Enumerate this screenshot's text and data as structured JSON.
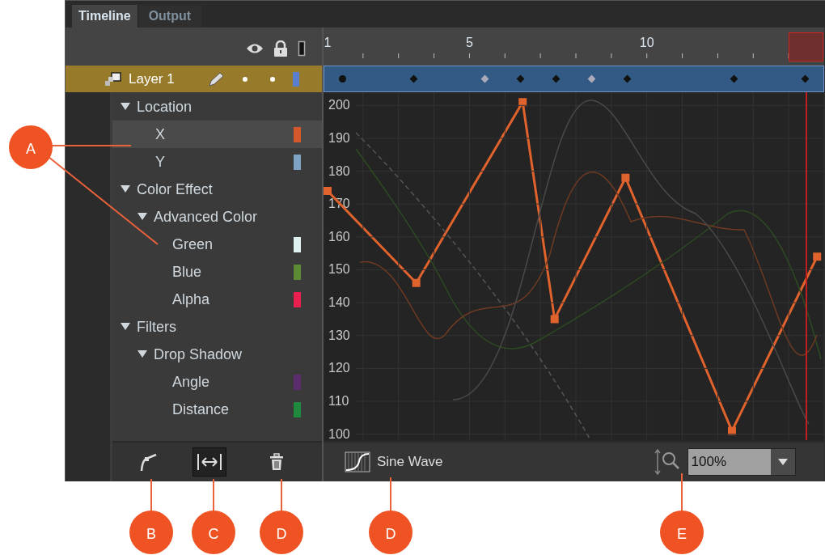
{
  "tabs": [
    {
      "label": "Timeline",
      "selected": true
    },
    {
      "label": "Output",
      "selected": false
    }
  ],
  "layer": {
    "name": "Layer 1"
  },
  "keyframes": [
    {
      "kind": "circle"
    },
    {
      "kind": "empty"
    },
    {
      "kind": "key"
    },
    {
      "kind": "empty"
    },
    {
      "kind": "roving"
    },
    {
      "kind": "key"
    },
    {
      "kind": "key"
    },
    {
      "kind": "roving"
    },
    {
      "kind": "key"
    },
    {
      "kind": "empty"
    },
    {
      "kind": "empty"
    },
    {
      "kind": "key"
    },
    {
      "kind": "empty"
    },
    {
      "kind": "key"
    }
  ],
  "properties": [
    {
      "label": "Location",
      "expanded": true,
      "children": [
        {
          "label": "X",
          "selected": true,
          "color": "#d4582a"
        },
        {
          "label": "Y",
          "selected": false,
          "color": "#7fa3c4"
        }
      ]
    },
    {
      "label": "Color Effect",
      "expanded": true,
      "children": [
        {
          "label": "Advanced Color",
          "expanded": true,
          "children": [
            {
              "label": "Green",
              "selected": false,
              "color": "#dff0f0"
            },
            {
              "label": "Blue",
              "selected": false,
              "color": "#5d8a35"
            },
            {
              "label": "Alpha",
              "selected": false,
              "color": "#e8204f"
            }
          ]
        }
      ]
    },
    {
      "label": "Filters",
      "expanded": true,
      "children": [
        {
          "label": "Drop Shadow",
          "expanded": true,
          "children": [
            {
              "label": "Angle",
              "selected": false,
              "color": "#5c2d6e"
            },
            {
              "label": "Distance",
              "selected": false,
              "color": "#1f8a3d"
            }
          ]
        }
      ]
    }
  ],
  "graph": {
    "chart_data": {
      "type": "line",
      "x": [
        1,
        3.5,
        6.5,
        7.4,
        9.4,
        12.4,
        14.8
      ],
      "series": [
        {
          "color": "#e0622c",
          "marker": "square",
          "values": [
            174,
            146,
            201,
            135,
            178,
            101,
            154
          ]
        }
      ],
      "grid": true,
      "xlim": [
        1,
        15
      ],
      "ylim": [
        85.4,
        223.7
      ],
      "xticks": [
        1,
        5,
        10
      ],
      "yticks": [
        100,
        110,
        120,
        130,
        140,
        150,
        160,
        170,
        180,
        190,
        200
      ]
    }
  },
  "footer": {
    "ease": "Sine Wave",
    "zoom": "100%"
  },
  "callouts": [
    {
      "label": "A"
    },
    {
      "label": "B"
    },
    {
      "label": "C"
    },
    {
      "label": "D"
    },
    {
      "label": "D"
    },
    {
      "label": "E"
    }
  ]
}
